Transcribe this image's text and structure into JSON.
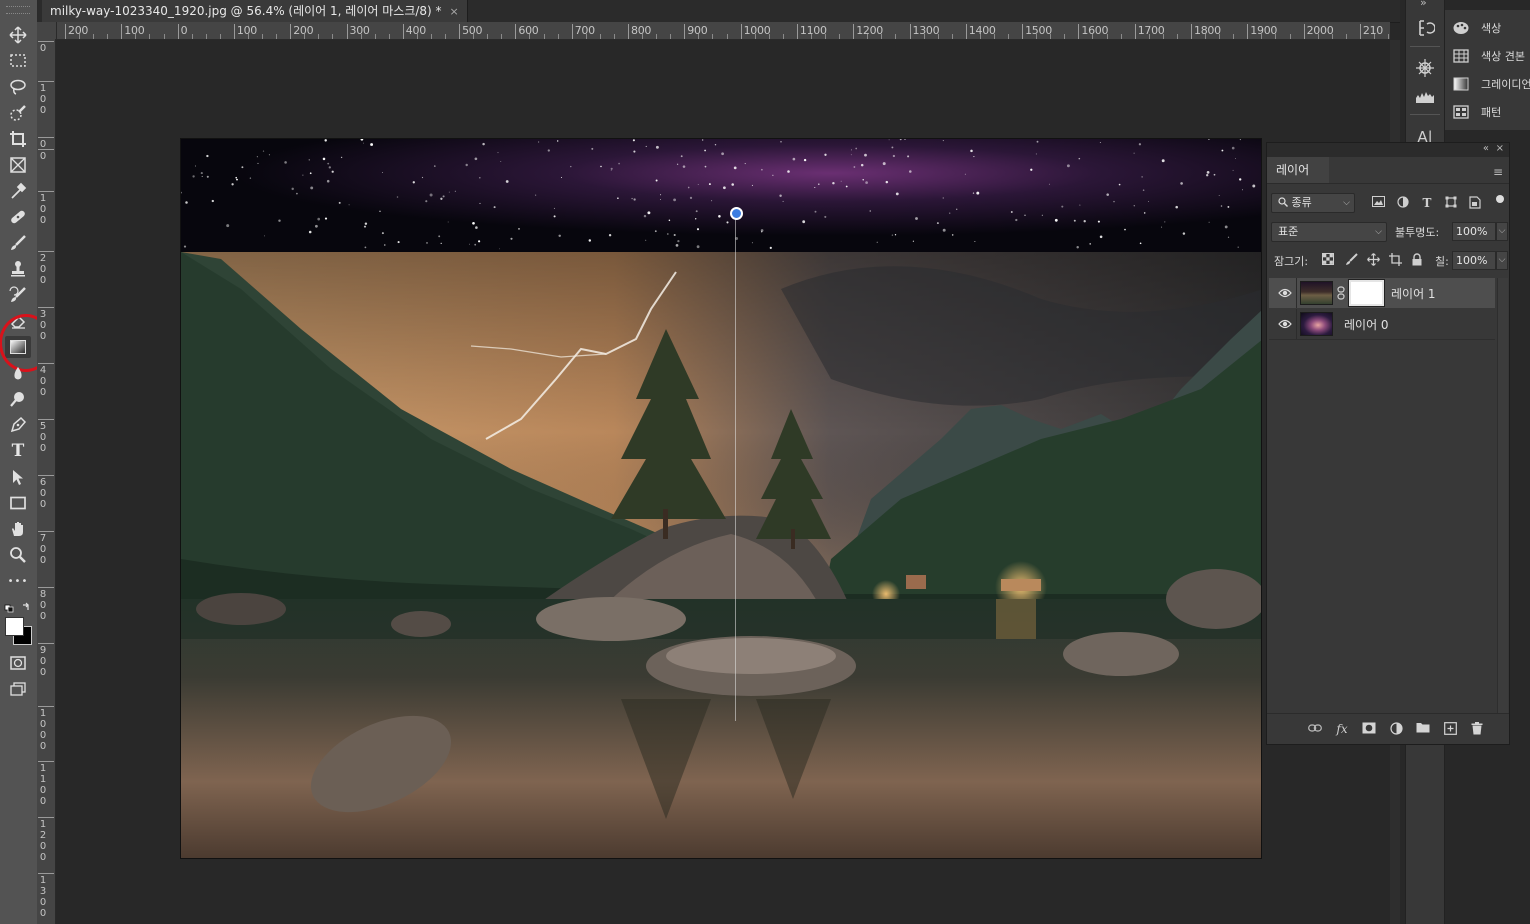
{
  "document_tab": {
    "title": "milky-way-1023340_1920.jpg @ 56.4% (레이어 1, 레이어 마스크/8) *",
    "close_glyph": "×"
  },
  "ruler_top_labels": [
    "200",
    "100",
    "0",
    "100",
    "200",
    "300",
    "400",
    "500",
    "600",
    "700",
    "800",
    "900",
    "1000",
    "1100",
    "1200",
    "1300",
    "1400",
    "1500",
    "1600",
    "1700",
    "1800",
    "1900",
    "2000",
    "210"
  ],
  "ruler_left_labels": [
    "0",
    "0",
    "1\n0\n0",
    "0",
    "1\n0\n0",
    "2\n0\n0",
    "3\n0\n0",
    "4\n0\n0",
    "5\n0\n0",
    "6\n0\n0",
    "7\n0\n0",
    "8\n0\n0",
    "9\n0\n0",
    "1\n0\n0\n0",
    "1\n1\n0\n0",
    "1\n2\n0\n0",
    "1\n3\n0\n0"
  ],
  "toolbar": {
    "tools": [
      "move-tool-icon",
      "marquee-tool-icon",
      "lasso-tool-icon",
      "quick-select-tool-icon",
      "crop-tool-icon",
      "frame-tool-icon",
      "eyedropper-tool-icon",
      "healing-brush-tool-icon",
      "brush-tool-icon",
      "stamp-tool-icon",
      "history-brush-tool-icon",
      "eraser-tool-icon",
      "gradient-tool-icon",
      "blur-tool-icon",
      "dodge-tool-icon",
      "pen-tool-icon",
      "type-tool-icon",
      "path-select-tool-icon",
      "rectangle-tool-icon",
      "hand-tool-icon",
      "zoom-tool-icon",
      "more-tools-icon"
    ],
    "selected_tool": "gradient-tool-icon",
    "highlight_color": "#d8121b",
    "type_glyph": "T",
    "more_glyph": "•••"
  },
  "mini_panel": {
    "items": [
      {
        "icon": "color-palette-icon",
        "label": "색상"
      },
      {
        "icon": "swatches-icon",
        "label": "색상 견본"
      },
      {
        "icon": "gradients-icon",
        "label": "그레이디언"
      },
      {
        "icon": "patterns-icon",
        "label": "패턴"
      }
    ]
  },
  "icon_strip": {
    "top_glyph": "»",
    "items": [
      "history-icon",
      "adjustments-icon",
      "histogram-icon",
      "character-icon"
    ],
    "character_glyph": "A|"
  },
  "layers_panel": {
    "collapse_glyph": "«",
    "close_glyph": "×",
    "tab_label": "레이어",
    "menu_glyph": "≡",
    "filter_label": "종류",
    "filter_icons": [
      "pixel-filter-icon",
      "adjustment-filter-icon",
      "type-filter-icon",
      "shape-filter-icon",
      "smart-object-filter-icon"
    ],
    "type_filter_glyph": "T",
    "blend_mode": "표준",
    "opacity_label": "불투명도:",
    "opacity_value": "100%",
    "lock_label": "잠그기:",
    "lock_icons": [
      "lock-transparent-icon",
      "lock-image-icon",
      "lock-position-icon",
      "lock-artboard-icon",
      "lock-all-icon"
    ],
    "fill_label": "칠:",
    "fill_value": "100%",
    "layers": [
      {
        "name": "레이어 1",
        "has_mask": true,
        "visible": true,
        "selected": true
      },
      {
        "name": "레이어 0",
        "has_mask": false,
        "visible": true,
        "selected": false
      }
    ],
    "footer_icons": [
      "link-layers-icon",
      "fx-icon",
      "add-mask-icon",
      "adjustment-layer-icon",
      "new-group-icon",
      "new-layer-icon",
      "delete-layer-icon"
    ],
    "fx_glyph": "fx"
  },
  "colors": {
    "accent_handle": "#3c7de0",
    "panel_bg": "#383838",
    "toolbar_bg": "#535353"
  }
}
